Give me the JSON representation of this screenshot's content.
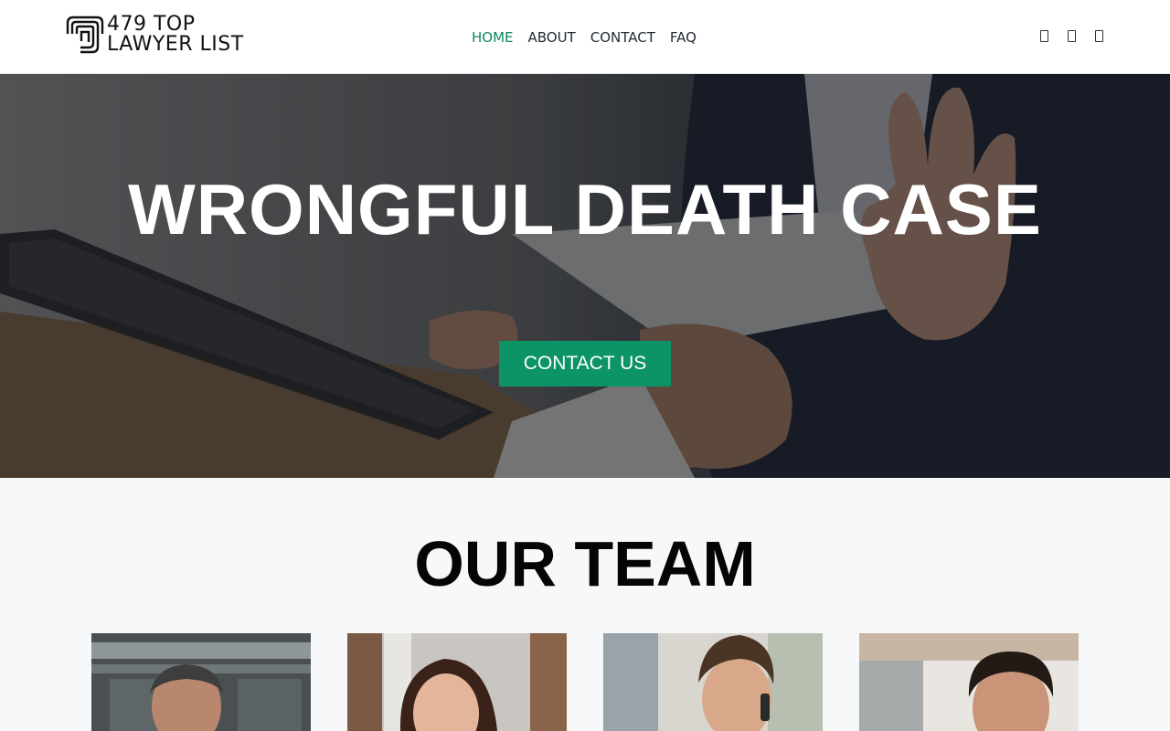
{
  "header": {
    "logo": {
      "line1": "479 TOP",
      "line2": "LAWYER LIST"
    },
    "nav": [
      {
        "label": "HOME",
        "active": true
      },
      {
        "label": "ABOUT",
        "active": false
      },
      {
        "label": "CONTACT",
        "active": false
      },
      {
        "label": "FAQ",
        "active": false
      }
    ],
    "social_icons": [
      "social-icon-1",
      "social-icon-2",
      "social-icon-3"
    ]
  },
  "hero": {
    "title": "WRONGFUL DEATH CASE",
    "button_label": "CONTACT US",
    "background_image": "handshake-envelope-office-photo"
  },
  "team": {
    "title": "OUR TEAM",
    "members": [
      {
        "photo": "man-grey-hair-suit-photo"
      },
      {
        "photo": "woman-brown-hair-photo"
      },
      {
        "photo": "man-on-phone-photo"
      },
      {
        "photo": "man-dark-hair-smiling-photo"
      }
    ]
  },
  "colors": {
    "accent": "#0d9466",
    "nav_active": "#0d8a5e",
    "nav_text": "#1f2a36",
    "team_bg": "#f7f8fa"
  }
}
